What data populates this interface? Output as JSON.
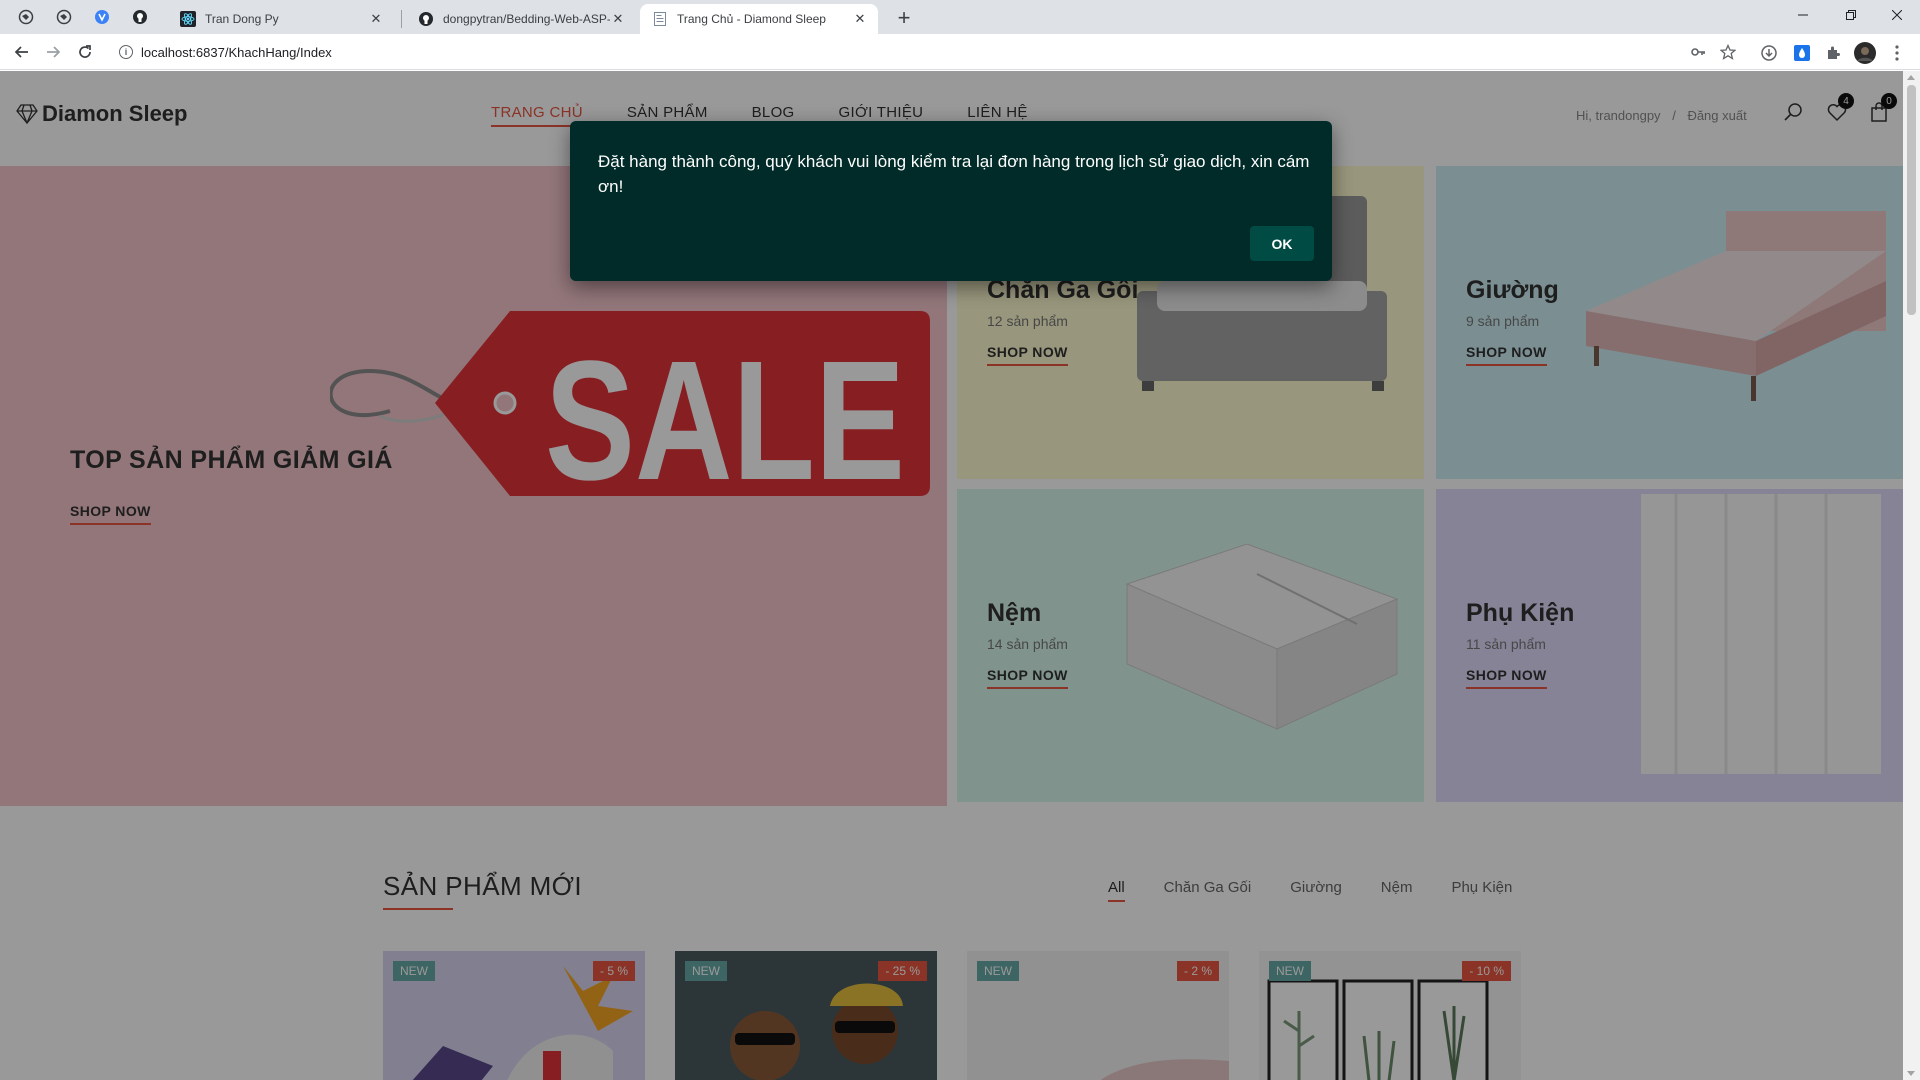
{
  "browser": {
    "tabs": [
      {
        "title": "Tran Dong Py"
      },
      {
        "title": "dongpytran/Bedding-Web-ASP-N"
      },
      {
        "title": "Trang Chủ - Diamond Sleep"
      }
    ],
    "url": "localhost:6837/KhachHang/Index",
    "close_glyph": "✕",
    "newtab_glyph": "+"
  },
  "header": {
    "logo": "Diamon Sleep",
    "nav": [
      "TRANG CHỦ",
      "SẢN PHẨM",
      "BLOG",
      "GIỚI THIỆU",
      "LIÊN HỆ"
    ],
    "greeting": "Hi, trandongpy",
    "separator": "/",
    "logout": "Đăng xuất",
    "wishlist_count": "4",
    "cart_count": "0"
  },
  "banner": {
    "main_title": "TOP SẢN PHẨM GIẢM GIÁ",
    "sale_text": "SALE",
    "shop_now": "SHOP NOW",
    "categories": [
      {
        "name": "Chăn Ga Gối",
        "count": "12 sản phẩm"
      },
      {
        "name": "Giường",
        "count": "9 sản phẩm"
      },
      {
        "name": "Nệm",
        "count": "14 sản phẩm"
      },
      {
        "name": "Phụ Kiện",
        "count": "11 sản phẩm"
      }
    ]
  },
  "new_products": {
    "title": "SẢN PHẨM MỚI",
    "filters": [
      "All",
      "Chăn Ga Gối",
      "Giường",
      "Nệm",
      "Phụ Kiện"
    ],
    "items": [
      {
        "badge": "NEW",
        "discount": "- 5 %"
      },
      {
        "badge": "NEW",
        "discount": "- 25 %"
      },
      {
        "badge": "NEW",
        "discount": "- 2 %"
      },
      {
        "badge": "NEW",
        "discount": "- 10 %"
      }
    ]
  },
  "dialog": {
    "message": "Đặt hàng thành công, quý khách vui lòng kiểm tra lại đơn hàng trong lịch sử giao dịch, xin cám ơn!",
    "ok": "OK"
  },
  "colors": {
    "accent": "#e65540",
    "dialog_bg": "#002b28",
    "ok_button": "#004c45",
    "cat_bedding": "#fdfbcf",
    "cat_bed": "#cdeef6",
    "cat_mattress": "#d6f7ec",
    "cat_accessory": "#e0dbfb",
    "banner_main": "#f4c5cc"
  }
}
